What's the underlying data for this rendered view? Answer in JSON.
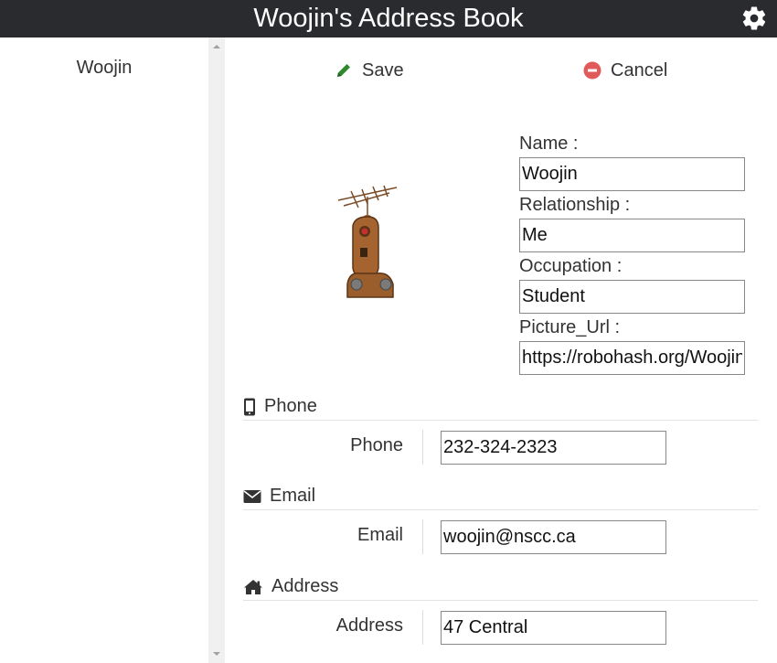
{
  "app": {
    "title": "Woojin's Address Book"
  },
  "sidebar": {
    "items": [
      {
        "label": "Woojin"
      }
    ]
  },
  "toolbar": {
    "save_label": "Save",
    "cancel_label": "Cancel"
  },
  "contact": {
    "fields": [
      {
        "label": "Name :",
        "value": "Woojin"
      },
      {
        "label": "Relationship :",
        "value": "Me"
      },
      {
        "label": "Occupation :",
        "value": "Student"
      },
      {
        "label": "Picture_Url :",
        "value": "https://robohash.org/Woojin"
      }
    ]
  },
  "sections": {
    "phone": {
      "title": "Phone",
      "label": "Phone",
      "value": "232-324-2323"
    },
    "email": {
      "title": "Email",
      "label": "Email",
      "value": "woojin@nscc.ca"
    },
    "address": {
      "title": "Address",
      "label": "Address",
      "value": "47 Central"
    }
  },
  "colors": {
    "header_bg": "#292b2f",
    "save_icon": "#2f8a2f",
    "cancel_icon": "#e05a5a"
  }
}
